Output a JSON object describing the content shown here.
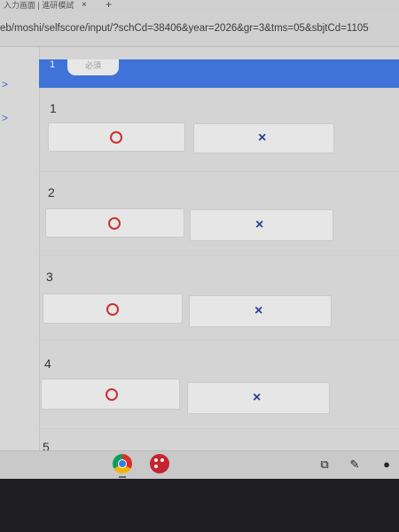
{
  "browser": {
    "tab_title": "入力画面 | 進研模試",
    "tab_close": "×",
    "new_tab": "+",
    "url": "eb/moshi/selfscore/input/?schCd=38406&year=2026&gr=3&tms=05&sbjtCd=1105"
  },
  "sidebar": {
    "chevrons": [
      ">",
      ">"
    ]
  },
  "header": {
    "number": "1",
    "pill_text": "必須"
  },
  "questions": [
    {
      "number": "1",
      "correct_label": "",
      "wrong_label": "×"
    },
    {
      "number": "2",
      "correct_label": "",
      "wrong_label": "×"
    },
    {
      "number": "3",
      "correct_label": "",
      "wrong_label": "×"
    },
    {
      "number": "4",
      "correct_label": "",
      "wrong_label": "×"
    },
    {
      "number": "5",
      "correct_label": "",
      "wrong_label": "×"
    }
  ],
  "colors": {
    "accent": "#3f73d8",
    "correct": "#c8322f",
    "wrong": "#2d3f91"
  },
  "shelf": {
    "apps": [
      "chrome-icon",
      "palette-icon"
    ],
    "tray": [
      "screen-capture-icon",
      "pen-icon",
      "status-icon"
    ]
  }
}
